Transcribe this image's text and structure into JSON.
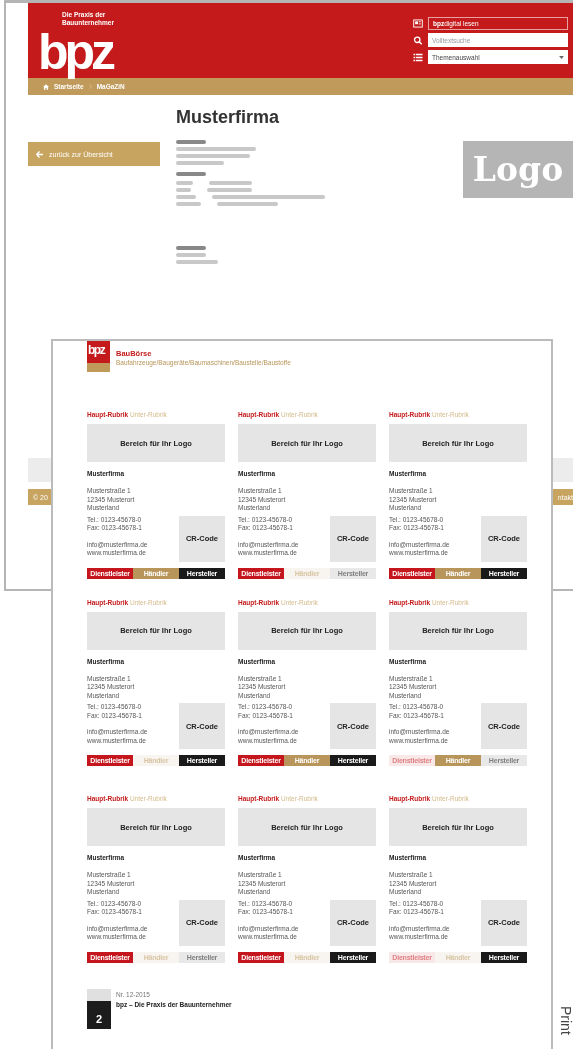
{
  "site": {
    "logo": "bpz",
    "tagline": "Die Praxis der Bauunternehmer",
    "digital": "**bpz**digital lesen",
    "search": {
      "placeholder": "Volltextsuche"
    },
    "topics": {
      "value": "Themenauswahl"
    },
    "breadcrumb": [
      "Startseite",
      "MaGaZiN"
    ],
    "back_button": "zurück zur Übersicht",
    "company": {
      "name": "Musterfirma"
    },
    "logo_placeholder": "Logo",
    "footer_left": "© 20",
    "footer_right": "ntakt"
  },
  "print_page": {
    "logo": "bpz",
    "title": "BauBörse",
    "subtitle": "Baufahrzeuge/Baugeräte/Baumaschinen/Baustelle/Baustoffe",
    "cards": [
      {
        "main": "Haupt-Rubrik",
        "sub": "Unter-Rubrik",
        "logo": "Bereich für Ihr Logo",
        "name": "Musterfirma",
        "address": [
          "Musterstraße 1",
          "12345 Musterort",
          "Musterland"
        ],
        "phone": [
          "Tel.: 0123-45678-0",
          "Fax: 0123-45678-1"
        ],
        "web": [
          "info@musterfirma.de",
          "www.musterfirma.de"
        ],
        "code": "CR-Code",
        "tags": [
          {
            "label": "Dienstleister",
            "kind": "service",
            "active": true
          },
          {
            "label": "Händler",
            "kind": "dealer",
            "active": true
          },
          {
            "label": "Hersteller",
            "kind": "maker",
            "active": true
          }
        ]
      },
      {
        "main": "Haupt-Rubrik",
        "sub": "Unter-Rubrik",
        "logo": "Bereich für Ihr Logo",
        "name": "Musterfirma",
        "address": [
          "Musterstraße 1",
          "12345 Musterort",
          "Musterland"
        ],
        "phone": [
          "Tel.: 0123-45678-0",
          "Fax: 0123-45678-1"
        ],
        "web": [
          "info@musterfirma.de",
          "www.musterfirma.de"
        ],
        "code": "CR-Code",
        "tags": [
          {
            "label": "Dienstleister",
            "kind": "service",
            "active": true
          },
          {
            "label": "Händler",
            "kind": "dealer",
            "active": false
          },
          {
            "label": "Hersteller",
            "kind": "maker",
            "active": false
          }
        ]
      },
      {
        "main": "Haupt-Rubrik",
        "sub": "Unter-Rubrik",
        "logo": "Bereich für Ihr Logo",
        "name": "Musterfirma",
        "address": [
          "Musterstraße 1",
          "12345 Musterort",
          "Musterland"
        ],
        "phone": [
          "Tel.: 0123-45678-0",
          "Fax: 0123-45678-1"
        ],
        "web": [
          "info@musterfirma.de",
          "www.musterfirma.de"
        ],
        "code": "CR-Code",
        "tags": [
          {
            "label": "Dienstleister",
            "kind": "service",
            "active": true
          },
          {
            "label": "Händler",
            "kind": "dealer",
            "active": true
          },
          {
            "label": "Hersteller",
            "kind": "maker",
            "active": true
          }
        ]
      },
      {
        "main": "Haupt-Rubrik",
        "sub": "Unter-Rubrik",
        "logo": "Bereich für Ihr Logo",
        "name": "Musterfirma",
        "address": [
          "Musterstraße 1",
          "12345 Musterort",
          "Musterland"
        ],
        "phone": [
          "Tel.: 0123-45678-0",
          "Fax: 0123-45678-1"
        ],
        "web": [
          "info@musterfirma.de",
          "www.musterfirma.de"
        ],
        "code": "CR-Code",
        "tags": [
          {
            "label": "Dienstleister",
            "kind": "service",
            "active": true
          },
          {
            "label": "Händler",
            "kind": "dealer",
            "active": false
          },
          {
            "label": "Hersteller",
            "kind": "maker",
            "active": true
          }
        ]
      },
      {
        "main": "Haupt-Rubrik",
        "sub": "Unter-Rubrik",
        "logo": "Bereich für Ihr Logo",
        "name": "Musterfirma",
        "address": [
          "Musterstraße 1",
          "12345 Musterort",
          "Musterland"
        ],
        "phone": [
          "Tel.: 0123-45678-0",
          "Fax: 0123-45678-1"
        ],
        "web": [
          "info@musterfirma.de",
          "www.musterfirma.de"
        ],
        "code": "CR-Code",
        "tags": [
          {
            "label": "Dienstleister",
            "kind": "service",
            "active": true
          },
          {
            "label": "Händler",
            "kind": "dealer",
            "active": true
          },
          {
            "label": "Hersteller",
            "kind": "maker",
            "active": true
          }
        ]
      },
      {
        "main": "Haupt-Rubrik",
        "sub": "Unter-Rubrik",
        "logo": "Bereich für Ihr Logo",
        "name": "Musterfirma",
        "address": [
          "Musterstraße 1",
          "12345 Musterort",
          "Musterland"
        ],
        "phone": [
          "Tel.: 0123-45678-0",
          "Fax: 0123-45678-1"
        ],
        "web": [
          "info@musterfirma.de",
          "www.musterfirma.de"
        ],
        "code": "CR-Code",
        "tags": [
          {
            "label": "Dienstleister",
            "kind": "service",
            "active": false
          },
          {
            "label": "Händler",
            "kind": "dealer",
            "active": true
          },
          {
            "label": "Hersteller",
            "kind": "maker",
            "active": false
          }
        ]
      },
      {
        "main": "Haupt-Rubrik",
        "sub": "Unter-Rubrik",
        "logo": "Bereich für Ihr Logo",
        "name": "Musterfirma",
        "address": [
          "Musterstraße 1",
          "12345 Musterort",
          "Musterland"
        ],
        "phone": [
          "Tel.: 0123-45678-0",
          "Fax: 0123-45678-1"
        ],
        "web": [
          "info@musterfirma.de",
          "www.musterfirma.de"
        ],
        "code": "CR-Code",
        "tags": [
          {
            "label": "Dienstleister",
            "kind": "service",
            "active": true
          },
          {
            "label": "Händler",
            "kind": "dealer",
            "active": false
          },
          {
            "label": "Hersteller",
            "kind": "maker",
            "active": false
          }
        ]
      },
      {
        "main": "Haupt-Rubrik",
        "sub": "Unter-Rubrik",
        "logo": "Bereich für Ihr Logo",
        "name": "Musterfirma",
        "address": [
          "Musterstraße 1",
          "12345 Musterort",
          "Musterland"
        ],
        "phone": [
          "Tel.: 0123-45678-0",
          "Fax: 0123-45678-1"
        ],
        "web": [
          "info@musterfirma.de",
          "www.musterfirma.de"
        ],
        "code": "CR-Code",
        "tags": [
          {
            "label": "Dienstleister",
            "kind": "service",
            "active": true
          },
          {
            "label": "Händler",
            "kind": "dealer",
            "active": false
          },
          {
            "label": "Hersteller",
            "kind": "maker",
            "active": true
          }
        ]
      },
      {
        "main": "Haupt-Rubrik",
        "sub": "Unter-Rubrik",
        "logo": "Bereich für Ihr Logo",
        "name": "Musterfirma",
        "address": [
          "Musterstraße 1",
          "12345 Musterort",
          "Musterland"
        ],
        "phone": [
          "Tel.: 0123-45678-0",
          "Fax: 0123-45678-1"
        ],
        "web": [
          "info@musterfirma.de",
          "www.musterfirma.de"
        ],
        "code": "CR-Code",
        "tags": [
          {
            "label": "Dienstleister",
            "kind": "service",
            "active": false
          },
          {
            "label": "Händler",
            "kind": "dealer",
            "active": false
          },
          {
            "label": "Hersteller",
            "kind": "maker",
            "active": true
          }
        ]
      }
    ],
    "issue": "Nr. 12-2015",
    "publication": "bpz – Die Praxis der Bauunternehmer",
    "page_number": "2"
  },
  "side_label": "Print"
}
